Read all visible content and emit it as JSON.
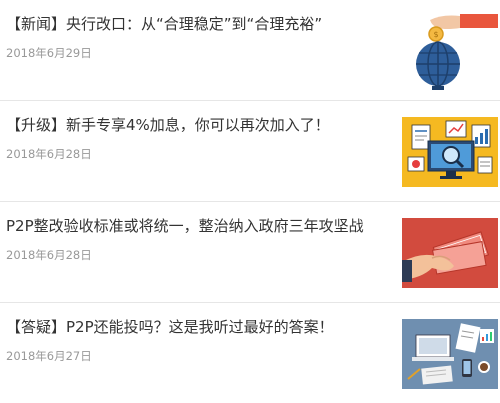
{
  "articles": [
    {
      "title": "【新闻】央行改口：从“合理稳定”到“合理充裕”",
      "date": "2018年6月29日",
      "thumbnail": "globe-coin-hand-illustration"
    },
    {
      "title": "【升级】新手专享4%加息，你可以再次加入了！",
      "date": "2018年6月28日",
      "thumbnail": "dashboard-analytics-illustration"
    },
    {
      "title": "P2P整改验收标准或将统一，整治纳入政府三年攻坚战",
      "date": "2018年6月28日",
      "thumbnail": "hand-cash-illustration"
    },
    {
      "title": "【答疑】P2P还能投吗？这是我听过最好的答案！",
      "date": "2018年6月27日",
      "thumbnail": "desk-workspace-illustration"
    }
  ],
  "colors": {
    "title": "#333333",
    "date": "#999999",
    "divider": "#e6e6e6"
  }
}
